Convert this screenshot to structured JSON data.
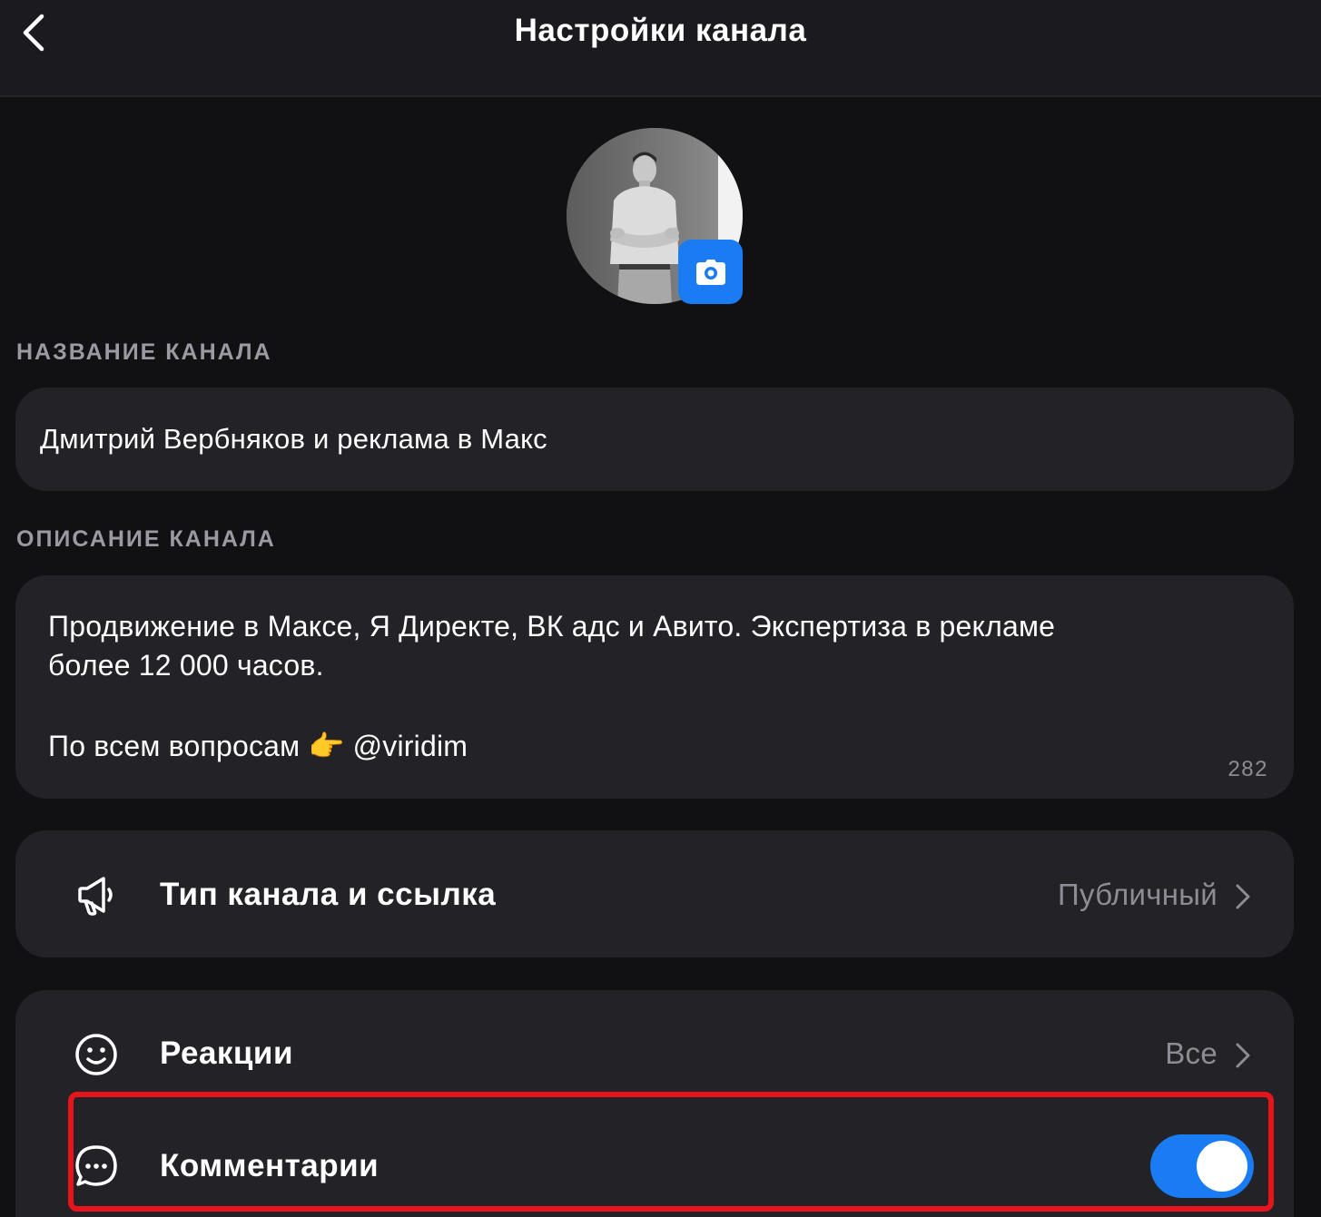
{
  "header": {
    "title": "Настройки канала"
  },
  "avatar": {
    "camera_icon": "camera-icon"
  },
  "channel_name": {
    "section_label": "НАЗВАНИЕ КАНАЛА",
    "value": "Дмитрий Вербняков и реклама в Макс"
  },
  "channel_description": {
    "section_label": "ОПИСАНИЕ КАНАЛА",
    "line1": "Продвижение в Максе, Я Директе, ВК адс и Авито. Экспертиза в рекламе",
    "line2": "более 12 000 часов.",
    "line3": "По всем вопросам 👉 @viridim",
    "char_count": "282"
  },
  "settings": {
    "channel_type": {
      "label": "Тип канала и ссылка",
      "value": "Публичный",
      "icon": "megaphone-icon"
    },
    "reactions": {
      "label": "Реакции",
      "value": "Все",
      "icon": "smile-icon"
    },
    "comments": {
      "label": "Комментарии",
      "enabled": true,
      "icon": "comment-bubble-icon"
    }
  },
  "colors": {
    "background": "#111114",
    "card": "#222227",
    "accent": "#1a7cf2",
    "highlight": "#e8141c",
    "muted_text": "#8c8c94"
  }
}
